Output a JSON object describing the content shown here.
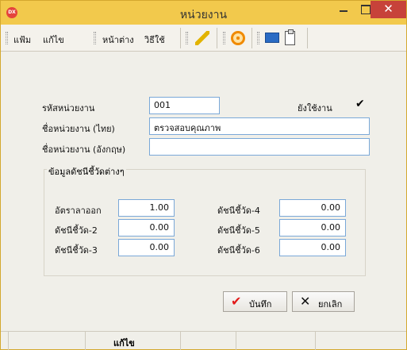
{
  "window": {
    "title": "หน่วยงาน",
    "app_icon_text": "DX",
    "close_glyph": "✕"
  },
  "toolbar": {
    "menu": [
      "แฟ้ม",
      "แก้ไข",
      "หน้าต่าง",
      "วิธีใช้"
    ],
    "icons": [
      "edit-icon",
      "target-icon",
      "screen-icon",
      "clipboard-icon"
    ]
  },
  "form": {
    "unit_code": {
      "label": "รหัสหน่วยงาน",
      "value": "001"
    },
    "active": {
      "label": "ยังใช้งาน",
      "checked": true,
      "check_glyph": "✔"
    },
    "name_th": {
      "label": "ชื่อหน่วยงาน (ไทย)",
      "value": "ตรวจสอบคุณภาพ"
    },
    "name_en": {
      "label": "ชื่อหน่วยงาน (อังกฤษ)",
      "value": ""
    }
  },
  "indicators": {
    "title": "ข้อมูลดัชนีชี้วัดต่างๆ",
    "items": [
      {
        "label": "อัตราลาออก",
        "value": "1.00"
      },
      {
        "label": "ดัชนีชี้วัด-2",
        "value": "0.00"
      },
      {
        "label": "ดัชนีชี้วัด-3",
        "value": "0.00"
      },
      {
        "label": "ดัชนีชี้วัด-4",
        "value": "0.00"
      },
      {
        "label": "ดัชนีชี้วัด-5",
        "value": "0.00"
      },
      {
        "label": "ดัชนีชี้วัด-6",
        "value": "0.00"
      }
    ]
  },
  "buttons": {
    "save_label": "บันทึก",
    "save_glyph": "✔",
    "cancel_label": "ยกเลิก",
    "cancel_glyph": "✕"
  },
  "status": {
    "mode": "แก้ไข"
  },
  "colors": {
    "titlebar": "#f2c94c",
    "close": "#c7423a",
    "save_icon": "#e21b1b"
  }
}
